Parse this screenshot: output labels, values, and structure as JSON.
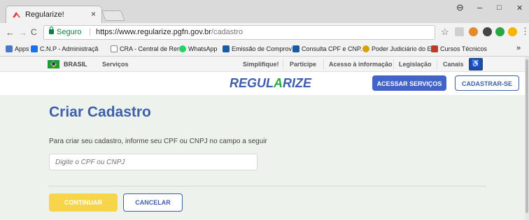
{
  "browser": {
    "tab_title": "Regularize!",
    "tab_close": "×",
    "window_controls": [
      "–",
      "□",
      "✕"
    ],
    "profile_glyph": "⊖",
    "security_label": "Seguro",
    "url_host": "https://www.regularize.pgfn.gov.br",
    "url_path": "/cadastro",
    "menu_glyph": "⋮",
    "extensions_more": "»"
  },
  "bookmarks": [
    {
      "label": "Apps",
      "icon": "apps-grid-icon",
      "color": "#4a78c8"
    },
    {
      "label": "C.N.P - Administraçã",
      "icon": "cnp-icon",
      "color": "#1a73e8"
    },
    {
      "label": "CRA - Central de Rer",
      "icon": "page-icon",
      "color": "#888888"
    },
    {
      "label": "WhatsApp",
      "icon": "whatsapp-icon",
      "color": "#25d366"
    },
    {
      "label": "Emissão de Comprov",
      "icon": "emissao-icon",
      "color": "#1d5aa6"
    },
    {
      "label": "Consulta CPF e CNP.",
      "icon": "consulta-icon",
      "color": "#1d5aa6"
    },
    {
      "label": "Poder Judiciário do E",
      "icon": "judiciario-icon",
      "color": "#d8a200"
    },
    {
      "label": "Cursos Técnicos",
      "icon": "cursos-icon",
      "color": "#c0392b"
    }
  ],
  "gov_bar": {
    "brasil": "BRASIL",
    "servicos": "Serviços",
    "items": [
      "Simplifique!",
      "Participe",
      "Acesso à informação",
      "Legislação",
      "Canais"
    ],
    "accessibility_glyph": "♿"
  },
  "header": {
    "logo_text_a": "REGUL",
    "logo_mark": "A",
    "logo_text_b": "RIZE",
    "access_button": "ACESSAR SERVIÇOS",
    "register_button": "CADASTRAR-SE"
  },
  "form": {
    "title": "Criar Cadastro",
    "instruction": "Para criar seu cadastro, informe seu CPF ou CNPJ no campo a seguir",
    "input_placeholder": "Digite o CPF ou CNPJ",
    "input_value": "",
    "continue_button": "CONTINUAR",
    "cancel_button": "CANCELAR"
  },
  "colors": {
    "brand_blue": "#3f5fad",
    "accent_yellow": "#f6d54a",
    "page_bg": "#eef2ec"
  }
}
